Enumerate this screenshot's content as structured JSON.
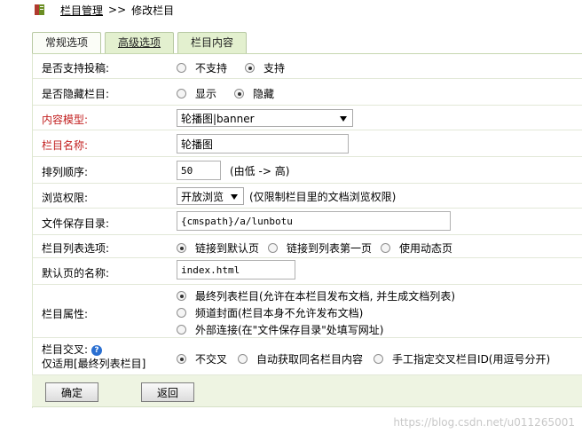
{
  "breadcrumb": {
    "icon": "book-icon",
    "root": "栏目管理",
    "separator": ">>",
    "current": "修改栏目"
  },
  "tabs": [
    {
      "label": "常规选项",
      "active": true
    },
    {
      "label": "高级选项",
      "active": false
    },
    {
      "label": "栏目内容",
      "active": false
    }
  ],
  "form": {
    "submission": {
      "label": "是否支持投稿:",
      "options": [
        "不支持",
        "支持"
      ],
      "selected": "支持"
    },
    "hidden": {
      "label": "是否隐藏栏目:",
      "options": [
        "显示",
        "隐藏"
      ],
      "selected": "隐藏"
    },
    "content_model": {
      "label": "内容模型:",
      "value": "轮播图|banner"
    },
    "name": {
      "label": "栏目名称:",
      "value": "轮播图"
    },
    "sort_order": {
      "label": "排列顺序:",
      "value": "50",
      "hint": "(由低 -> 高)"
    },
    "browse_permission": {
      "label": "浏览权限:",
      "value": "开放浏览",
      "hint": "(仅限制栏目里的文档浏览权限)"
    },
    "save_dir": {
      "label": "文件保存目录:",
      "value": "{cmspath}/a/lunbotu"
    },
    "list_option": {
      "label": "栏目列表选项:",
      "options": [
        "链接到默认页",
        "链接到列表第一页",
        "使用动态页"
      ],
      "selected": "链接到默认页"
    },
    "default_page": {
      "label": "默认页的名称:",
      "value": "index.html"
    },
    "attribute": {
      "label": "栏目属性:",
      "options": [
        "最终列表栏目(允许在本栏目发布文档, 并生成文档列表)",
        "频道封面(栏目本身不允许发布文档)",
        "外部连接(在\"文件保存目录\"处填写网址)"
      ],
      "selected": "最终列表栏目(允许在本栏目发布文档, 并生成文档列表)"
    },
    "cross": {
      "label": "栏目交叉:",
      "help_icon": "question-icon",
      "note": "仅适用[最终列表栏目]",
      "options": [
        "不交叉",
        "自动获取同名栏目内容",
        "手工指定交叉栏目ID(用逗号分开)"
      ],
      "selected": "不交叉"
    }
  },
  "buttons": {
    "confirm": "确定",
    "back": "返回"
  },
  "watermark": "https://blog.csdn.net/u011265001"
}
